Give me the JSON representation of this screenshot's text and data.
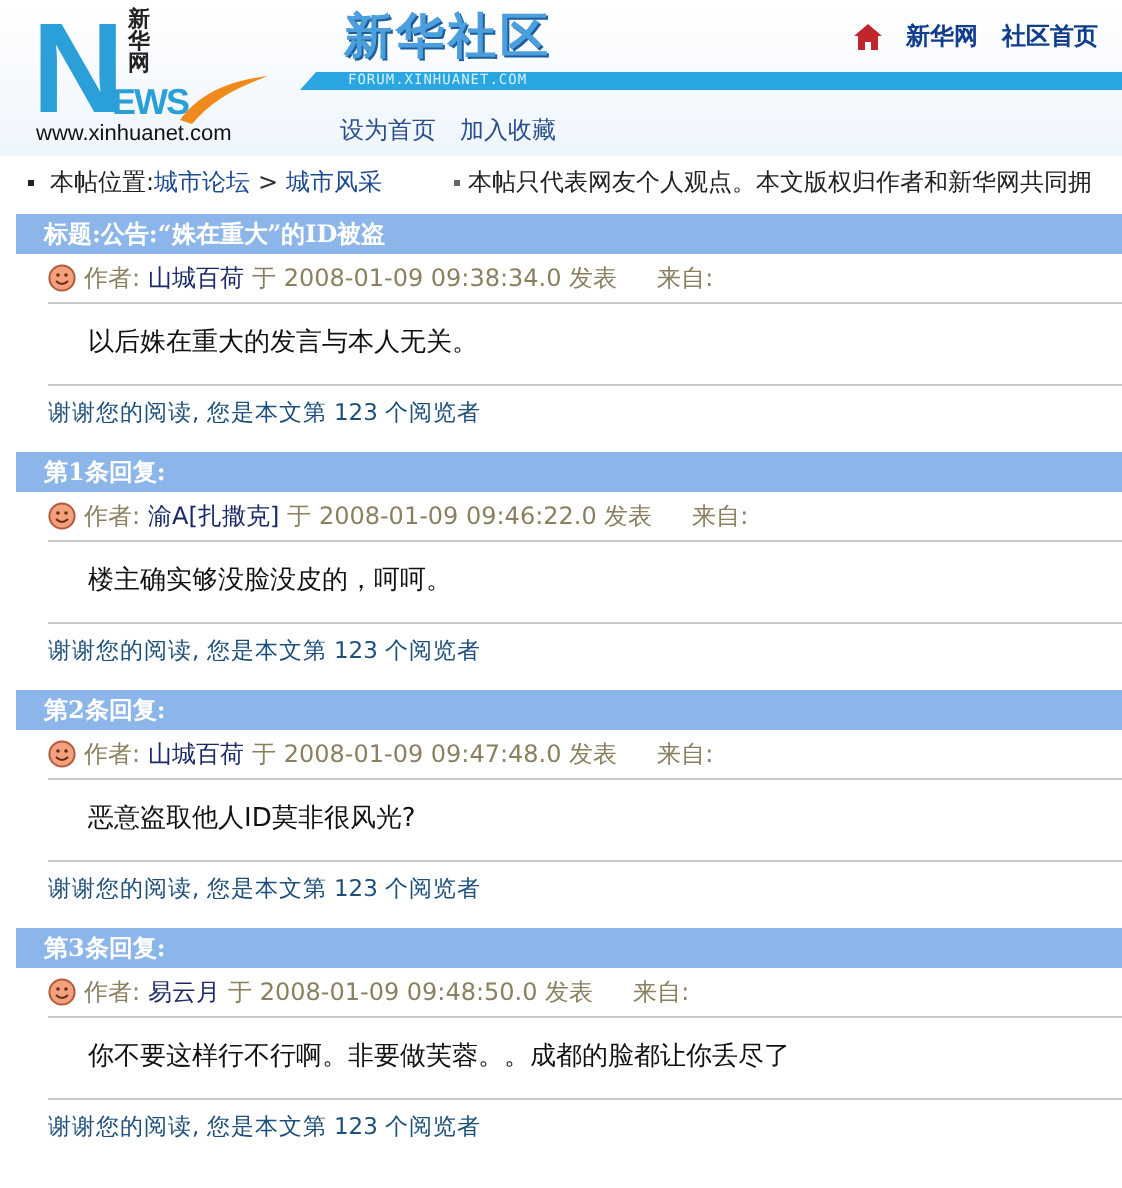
{
  "header": {
    "logo_n": "N",
    "logo_cn": "新华网",
    "logo_ews": "EWS",
    "logo_url": "www.xinhuanet.com",
    "site_title": "新华社区",
    "site_domain": "FORUM.XINHUANET.COM",
    "top_links": [
      "新华网",
      "社区首页"
    ],
    "sub_links": [
      "设为首页",
      "加入收藏"
    ]
  },
  "location_bar": {
    "label": "本帖位置",
    "separator": ":",
    "crumbs": [
      "城市论坛",
      "城市风采"
    ],
    "crumb_separator": ">",
    "notice": "本帖只代表网友个人观点。本文版权归作者和新华网共同拥"
  },
  "posts": [
    {
      "heading": "标题:公告:“姝在重大”的ID被盗",
      "author_label": "作者:",
      "author": "山城百荷",
      "posted": "于 2008-01-09 09:38:34.0 发表",
      "from_label": "来自:",
      "body": "以后姝在重大的发言与本人无关。",
      "footer": "谢谢您的阅读, 您是本文第 123 个阅览者"
    },
    {
      "heading": "第1条回复:",
      "author_label": "作者:",
      "author": "渝A[扎撒克]",
      "posted": "于 2008-01-09 09:46:22.0 发表",
      "from_label": "来自:",
      "body": "楼主确实够没脸没皮的，呵呵。",
      "footer": "谢谢您的阅读, 您是本文第 123 个阅览者"
    },
    {
      "heading": "第2条回复:",
      "author_label": "作者:",
      "author": "山城百荷",
      "posted": "于 2008-01-09 09:47:48.0 发表",
      "from_label": "来自:",
      "body": "恶意盗取他人ID莫非很风光?",
      "footer": "谢谢您的阅读, 您是本文第 123 个阅览者"
    },
    {
      "heading": "第3条回复:",
      "author_label": "作者:",
      "author": "易云月",
      "posted": "于 2008-01-09 09:48:50.0 发表",
      "from_label": "来自:",
      "body": "你不要这样行不行啊。非要做芙蓉。。成都的脸都让你丢尽了",
      "footer": "谢谢您的阅读, 您是本文第 123 个阅览者"
    }
  ]
}
